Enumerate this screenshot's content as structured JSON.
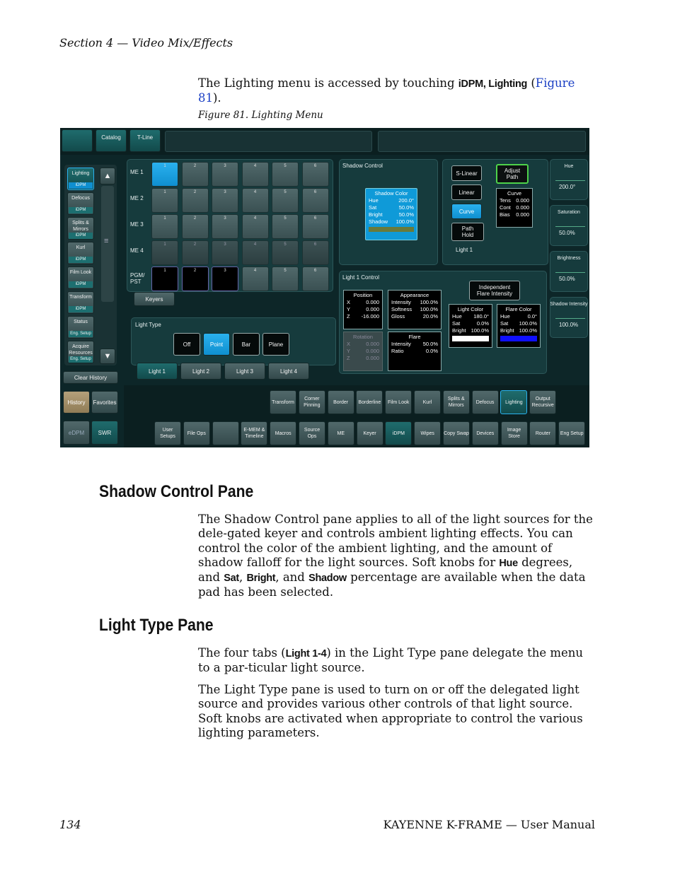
{
  "header": {
    "section": "Section 4 — Video Mix/Effects"
  },
  "intro": {
    "prefix": "The Lighting menu is accessed by touching ",
    "cmd": "iDPM, Lighting",
    "open": " (",
    "link": "Figure 81",
    "close": ")."
  },
  "figure": {
    "caption": "Figure 81.  Lighting Menu"
  },
  "ui": {
    "top_tabs": [
      "",
      "Catalog",
      "T-Line"
    ],
    "left_menu": [
      {
        "label": "Lighting",
        "sub": "iDPM"
      },
      {
        "label": "Defocus",
        "sub": "iDPM"
      },
      {
        "label": "Splits & Mirrors",
        "sub": "iDPM"
      },
      {
        "label": "Kurl",
        "sub": "iDPM"
      },
      {
        "label": "Film Look",
        "sub": "iDPM"
      },
      {
        "label": "Transform",
        "sub": "iDPM"
      },
      {
        "label": "Status",
        "sub": "Eng. Setup"
      },
      {
        "label": "Acquire Resources",
        "sub": "Eng. Setup"
      }
    ],
    "scroll_up": "▲",
    "scroll_mid": "≡",
    "scroll_down": "▼",
    "clear_history": "Clear History",
    "history": "History",
    "favorites": "Favorites",
    "edpm": "eDPM",
    "swr": "SWR",
    "me_rows": [
      "ME 1",
      "ME 2",
      "ME 3",
      "ME 4",
      "PGM/ PST"
    ],
    "cell_nums": [
      "1",
      "2",
      "3",
      "4",
      "5",
      "6"
    ],
    "keyers": "Keyers",
    "light_type": {
      "title": "Light Type",
      "buttons": [
        "Off",
        "Point",
        "Bar",
        "Plane"
      ]
    },
    "light_tabs": [
      "Light 1",
      "Light 2",
      "Light 3",
      "Light 4"
    ],
    "shadow": {
      "title": "Shadow Control",
      "box_title": "Shadow Color",
      "rows": [
        [
          "Hue",
          "200.0°"
        ],
        [
          "Sat",
          "50.0%"
        ],
        [
          "Bright",
          "50.0%"
        ],
        [
          "Shadow",
          "100.0%"
        ]
      ]
    },
    "curve": {
      "s_linear": "S-Linear",
      "linear": "Linear",
      "curve": "Curve",
      "path_hold": "Path Hold",
      "adjust_path": "Adjust Path",
      "curve_box": {
        "title": "Curve",
        "rows": [
          [
            "Tens",
            "0.000"
          ],
          [
            "Cont",
            "0.000"
          ],
          [
            "Bias",
            "0.000"
          ]
        ]
      },
      "light_label": "Light 1"
    },
    "knobs": [
      {
        "label": "Hue",
        "value": "200.0°"
      },
      {
        "label": "Saturation",
        "value": "50.0%"
      },
      {
        "label": "Brightness",
        "value": "50.0%"
      },
      {
        "label": "Shadow Intensity",
        "value": "100.0%"
      }
    ],
    "light_control": {
      "title": "Light 1 Control",
      "independent": "Independent Flare Intensity",
      "position": {
        "title": "Position",
        "rows": [
          [
            "X",
            "0.000"
          ],
          [
            "Y",
            "0.000"
          ],
          [
            "Z",
            "-16.000"
          ]
        ]
      },
      "appearance": {
        "title": "Appearance",
        "rows": [
          [
            "Intensity",
            "100.0%"
          ],
          [
            "Softness",
            "100.0%"
          ],
          [
            "Gloss",
            "20.0%"
          ]
        ]
      },
      "rotation": {
        "title": "Rotation",
        "rows": [
          [
            "X",
            "0.000"
          ],
          [
            "Y",
            "0.000"
          ],
          [
            "Z",
            "0.000"
          ]
        ]
      },
      "flare": {
        "title": "Flare",
        "rows": [
          [
            "Intensity",
            "50.0%"
          ],
          [
            "Ratio",
            "0.0%"
          ]
        ]
      },
      "light_color": {
        "title": "Light Color",
        "rows": [
          [
            "Hue",
            "180.0°"
          ],
          [
            "Sat",
            "0.0%"
          ],
          [
            "Bright",
            "100.0%"
          ]
        ],
        "swatch": "#ffffff"
      },
      "flare_color": {
        "title": "Flare Color",
        "rows": [
          [
            "Hue",
            "0.0°"
          ],
          [
            "Sat",
            "100.0%"
          ],
          [
            "Bright",
            "100.0%"
          ]
        ],
        "swatch": "#1010ff"
      }
    },
    "bottom_row1": [
      "Transform",
      "Corner Pinning",
      "Border",
      "Borderline",
      "Film Look",
      "Kurl",
      "Splits & Mirrors",
      "Defocus",
      "Lighting",
      "Output Recursive"
    ],
    "bottom_row2": [
      "User Setups",
      "File Ops",
      "",
      "E-MEM & Timeline",
      "Macros",
      "Source Ops",
      "ME",
      "Keyer",
      "iDPM",
      "Wipes",
      "Copy Swap",
      "Devices",
      "Image Store",
      "Router",
      "Eng Setup"
    ]
  },
  "shadow_section": {
    "heading": "Shadow Control Pane",
    "t1": "The Shadow Control pane applies to all of the light sources for the dele-gated keyer and controls ambient lighting effects. You can control the color of the ambient lighting, and the amount of shadow falloff for the light sources. Soft knobs for ",
    "c1": "Hue",
    "t2": " degrees, and ",
    "c2": "Sat",
    "t3": ", ",
    "c3": "Bright",
    "t4": ", and ",
    "c4": "Shadow",
    "t5": " percentage are available when the data pad has been selected."
  },
  "light_section": {
    "heading": "Light Type Pane",
    "p1a": "The four tabs (",
    "p1cmd": "Light 1-4",
    "p1b": ") in the Light Type pane delegate the menu to a par-ticular light source.",
    "p2": "The Light Type pane is used to turn on or off the delegated light source and provides various other controls of that light source. Soft knobs are activated when appropriate to control the various lighting parameters."
  },
  "footer": {
    "page": "134",
    "title": "KAYENNE K-FRAME  —  User Manual"
  }
}
